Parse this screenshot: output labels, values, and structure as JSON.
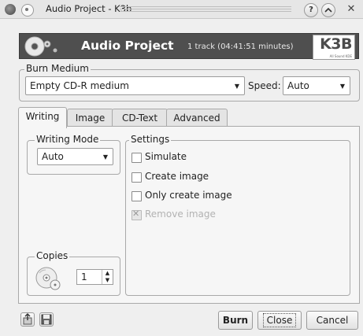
{
  "window": {
    "title": "Audio Project - K3b"
  },
  "header": {
    "title": "Audio Project",
    "subtitle": "1 track (04:41:51 minutes)",
    "logo_text": "K3B",
    "logo_subtext": "All Sound KDE"
  },
  "burn_medium": {
    "legend": "Burn Medium",
    "medium_value": "Empty CD-R medium",
    "speed_label": "Speed:",
    "speed_value": "Auto"
  },
  "tabs": [
    {
      "label": "Writing",
      "active": true
    },
    {
      "label": "Image",
      "active": false
    },
    {
      "label": "CD-Text",
      "active": false
    },
    {
      "label": "Advanced",
      "active": false
    }
  ],
  "writing_mode": {
    "legend": "Writing Mode",
    "value": "Auto"
  },
  "settings": {
    "legend": "Settings",
    "options": [
      {
        "label": "Simulate",
        "checked": false,
        "enabled": true
      },
      {
        "label": "Create image",
        "checked": false,
        "enabled": true
      },
      {
        "label": "Only create image",
        "checked": false,
        "enabled": true
      },
      {
        "label": "Remove image",
        "checked": true,
        "enabled": false
      }
    ]
  },
  "copies": {
    "legend": "Copies",
    "value": "1"
  },
  "buttons": {
    "burn": "Burn",
    "close": "Close",
    "cancel": "Cancel"
  },
  "icons": {
    "window_menu": "window-menu-icon",
    "sticky": "pin-icon",
    "help": "help-icon",
    "minimize": "minimize-icon",
    "close": "close-icon",
    "project": "audio-cd-icon",
    "copies": "cd-copy-icon",
    "load_settings": "load-settings-icon",
    "save_settings": "save-settings-icon"
  }
}
